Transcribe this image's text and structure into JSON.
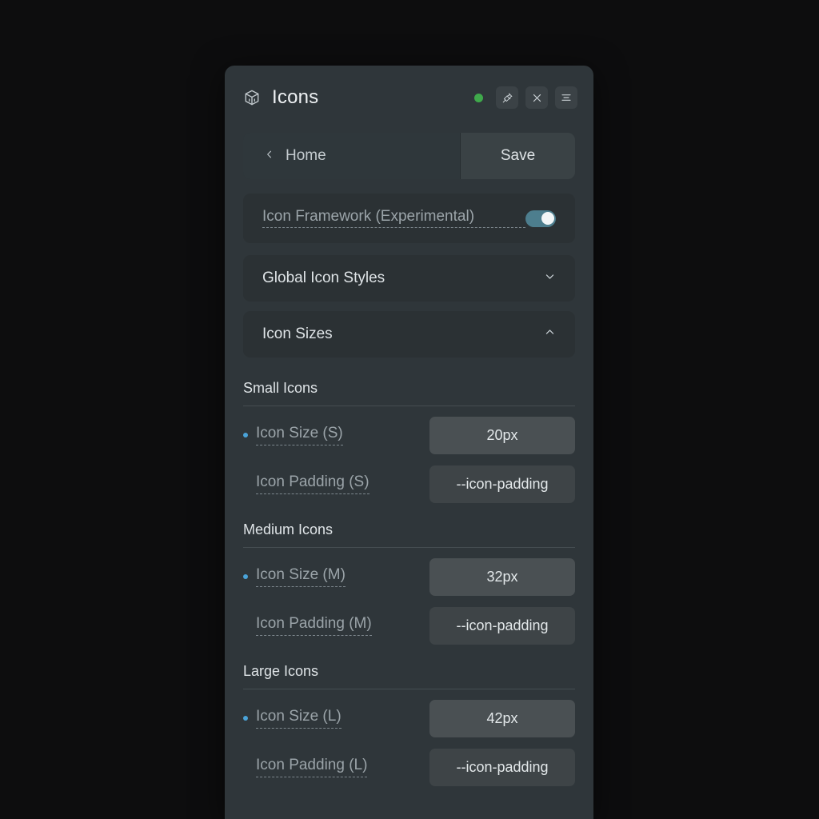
{
  "window": {
    "title": "Icons",
    "logo_icon": "cube-icon",
    "status_dot_color": "#3fa94b",
    "buttons": [
      {
        "name": "pin-icon",
        "label": "Pin"
      },
      {
        "name": "close-icon",
        "label": "Close"
      },
      {
        "name": "menu-icon",
        "label": "Menu"
      }
    ]
  },
  "nav": {
    "back_icon": "chevron-left-icon",
    "home_label": "Home",
    "save_label": "Save"
  },
  "framework_toggle": {
    "label": "Icon Framework (Experimental)",
    "enabled": true,
    "accent": "#4d7e8e"
  },
  "sections": [
    {
      "title": "Global Icon Styles",
      "expanded": false,
      "chevron": "chevron-down-icon"
    },
    {
      "title": "Icon Sizes",
      "expanded": true,
      "chevron": "chevron-up-icon"
    }
  ],
  "groups": [
    {
      "heading": "Small Icons",
      "rows": [
        {
          "label": "Icon Size (S)",
          "value": "20px",
          "modified": true,
          "style": "strong"
        },
        {
          "label": "Icon Padding (S)",
          "value": "--icon-padding",
          "modified": false,
          "style": "muted"
        }
      ]
    },
    {
      "heading": "Medium Icons",
      "rows": [
        {
          "label": "Icon Size (M)",
          "value": "32px",
          "modified": true,
          "style": "strong"
        },
        {
          "label": "Icon Padding (M)",
          "value": "--icon-padding",
          "modified": false,
          "style": "muted"
        }
      ]
    },
    {
      "heading": "Large Icons",
      "rows": [
        {
          "label": "Icon Size (L)",
          "value": "42px",
          "modified": true,
          "style": "strong"
        },
        {
          "label": "Icon Padding (L)",
          "value": "--icon-padding",
          "modified": false,
          "style": "muted"
        }
      ]
    }
  ],
  "colors": {
    "page_background": "#0d0d0e",
    "panel_background": "#2f363a",
    "card_background": "#2b3134",
    "field_strong": "#4a5053",
    "field_muted": "#3e4447",
    "modified_dot": "#4aa3d8",
    "text_primary": "#dfe4e7",
    "text_muted": "#9ba4a9"
  }
}
